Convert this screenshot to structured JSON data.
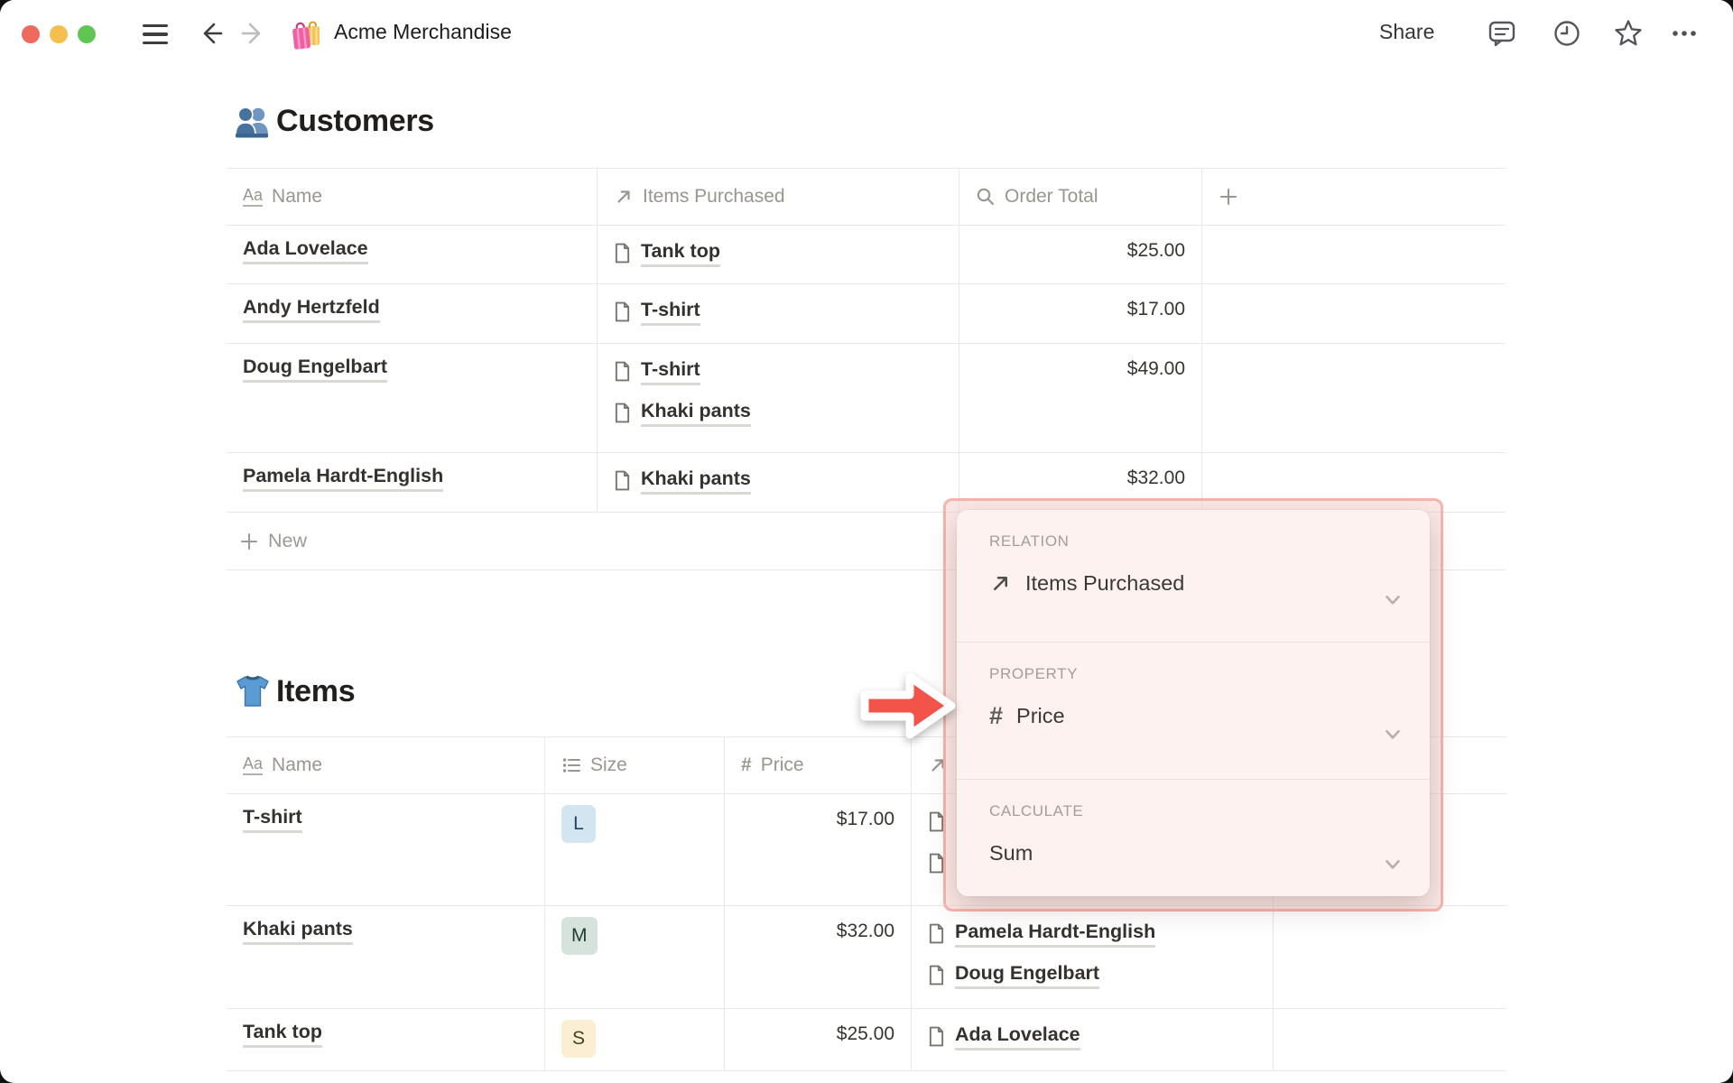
{
  "window": {
    "title": "Acme Merchandise"
  },
  "topbar": {
    "share": "Share",
    "icons": [
      "comments-icon",
      "history-icon",
      "favorite-icon",
      "more-icon"
    ]
  },
  "customers": {
    "heading": "Customers",
    "columns": [
      {
        "icon": "text-property-icon",
        "label": "Name"
      },
      {
        "icon": "relation-property-icon",
        "label": "Items Purchased"
      },
      {
        "icon": "rollup-property-icon",
        "label": "Order Total"
      },
      {
        "icon": "add-property-icon",
        "label": ""
      }
    ],
    "rows": [
      {
        "name": "Ada Lovelace",
        "items": [
          "Tank top"
        ],
        "total": "$25.00"
      },
      {
        "name": "Andy Hertzfeld",
        "items": [
          "T-shirt"
        ],
        "total": "$17.00"
      },
      {
        "name": "Doug Engelbart",
        "items": [
          "T-shirt",
          "Khaki pants"
        ],
        "total": "$49.00"
      },
      {
        "name": "Pamela Hardt-English",
        "items": [
          "Khaki pants"
        ],
        "total": "$32.00"
      }
    ],
    "new_label": "New"
  },
  "items": {
    "heading": "Items",
    "columns": [
      {
        "icon": "text-property-icon",
        "label": "Name"
      },
      {
        "icon": "select-property-icon",
        "label": "Size"
      },
      {
        "icon": "number-property-icon",
        "label": "Price"
      },
      {
        "icon": "relation-property-icon",
        "label": ""
      }
    ],
    "rows": [
      {
        "name": "T-shirt",
        "size": "L",
        "size_color": "blue",
        "price": "$17.00",
        "purchasers": [],
        "clipped_purchaser_icons": 2
      },
      {
        "name": "Khaki pants",
        "size": "M",
        "size_color": "green",
        "price": "$32.00",
        "purchasers": [
          "Pamela Hardt-English",
          "Doug Engelbart"
        ]
      },
      {
        "name": "Tank top",
        "size": "S",
        "size_color": "yellow",
        "price": "$25.00",
        "purchasers": [
          "Ada Lovelace"
        ]
      }
    ]
  },
  "popup": {
    "relation_label": "RELATION",
    "relation_value": "Items Purchased",
    "property_label": "PROPERTY",
    "property_value": "Price",
    "calculate_label": "CALCULATE",
    "calculate_value": "Sum"
  },
  "colors": {
    "arrow_red": "#f2544a",
    "popup_border": "#f6b5ad",
    "popup_bg": "#fdf2f0",
    "badge_blue_bg": "#d3e5f0",
    "badge_green_bg": "#d6e3dd",
    "badge_yellow_bg": "#fbeed3",
    "traffic_red": "#ee6a5f",
    "traffic_yellow": "#f4bf4f",
    "traffic_green": "#61c554"
  }
}
